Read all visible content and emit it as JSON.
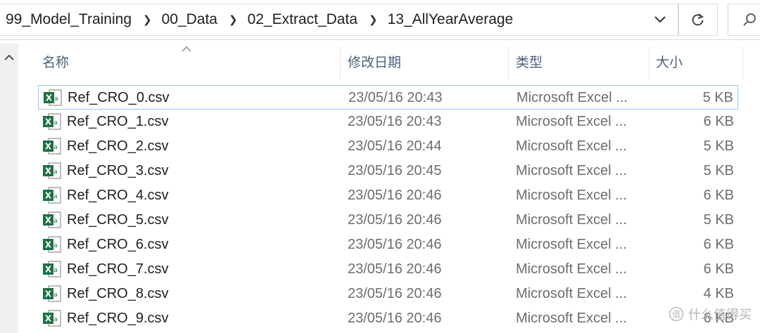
{
  "breadcrumb": [
    "99_Model_Training",
    "00_Data",
    "02_Extract_Data",
    "13_AllYearAverage"
  ],
  "columns": {
    "name": "名称",
    "date": "修改日期",
    "type": "类型",
    "size": "大小"
  },
  "files": [
    {
      "name": "Ref_CRO_0.csv",
      "date": "23/05/16 20:43",
      "type": "Microsoft Excel ...",
      "size": "5 KB"
    },
    {
      "name": "Ref_CRO_1.csv",
      "date": "23/05/16 20:43",
      "type": "Microsoft Excel ...",
      "size": "6 KB"
    },
    {
      "name": "Ref_CRO_2.csv",
      "date": "23/05/16 20:44",
      "type": "Microsoft Excel ...",
      "size": "5 KB"
    },
    {
      "name": "Ref_CRO_3.csv",
      "date": "23/05/16 20:45",
      "type": "Microsoft Excel ...",
      "size": "5 KB"
    },
    {
      "name": "Ref_CRO_4.csv",
      "date": "23/05/16 20:46",
      "type": "Microsoft Excel ...",
      "size": "6 KB"
    },
    {
      "name": "Ref_CRO_5.csv",
      "date": "23/05/16 20:46",
      "type": "Microsoft Excel ...",
      "size": "5 KB"
    },
    {
      "name": "Ref_CRO_6.csv",
      "date": "23/05/16 20:46",
      "type": "Microsoft Excel ...",
      "size": "6 KB"
    },
    {
      "name": "Ref_CRO_7.csv",
      "date": "23/05/16 20:46",
      "type": "Microsoft Excel ...",
      "size": "6 KB"
    },
    {
      "name": "Ref_CRO_8.csv",
      "date": "23/05/16 20:46",
      "type": "Microsoft Excel ...",
      "size": "4 KB"
    },
    {
      "name": "Ref_CRO_9.csv",
      "date": "23/05/16 20:46",
      "type": "Microsoft Excel ...",
      "size": "6 KB"
    }
  ],
  "watermark": "什么值得买",
  "colors": {
    "excel_green": "#1e7145",
    "header_text": "#4c607a",
    "focus_border": "#99c9f0"
  },
  "icons": {
    "file": "excel-csv-icon",
    "sep": "chevron-right-icon",
    "dropdown": "chevron-down-icon",
    "refresh": "refresh-icon",
    "search": "search-icon"
  }
}
